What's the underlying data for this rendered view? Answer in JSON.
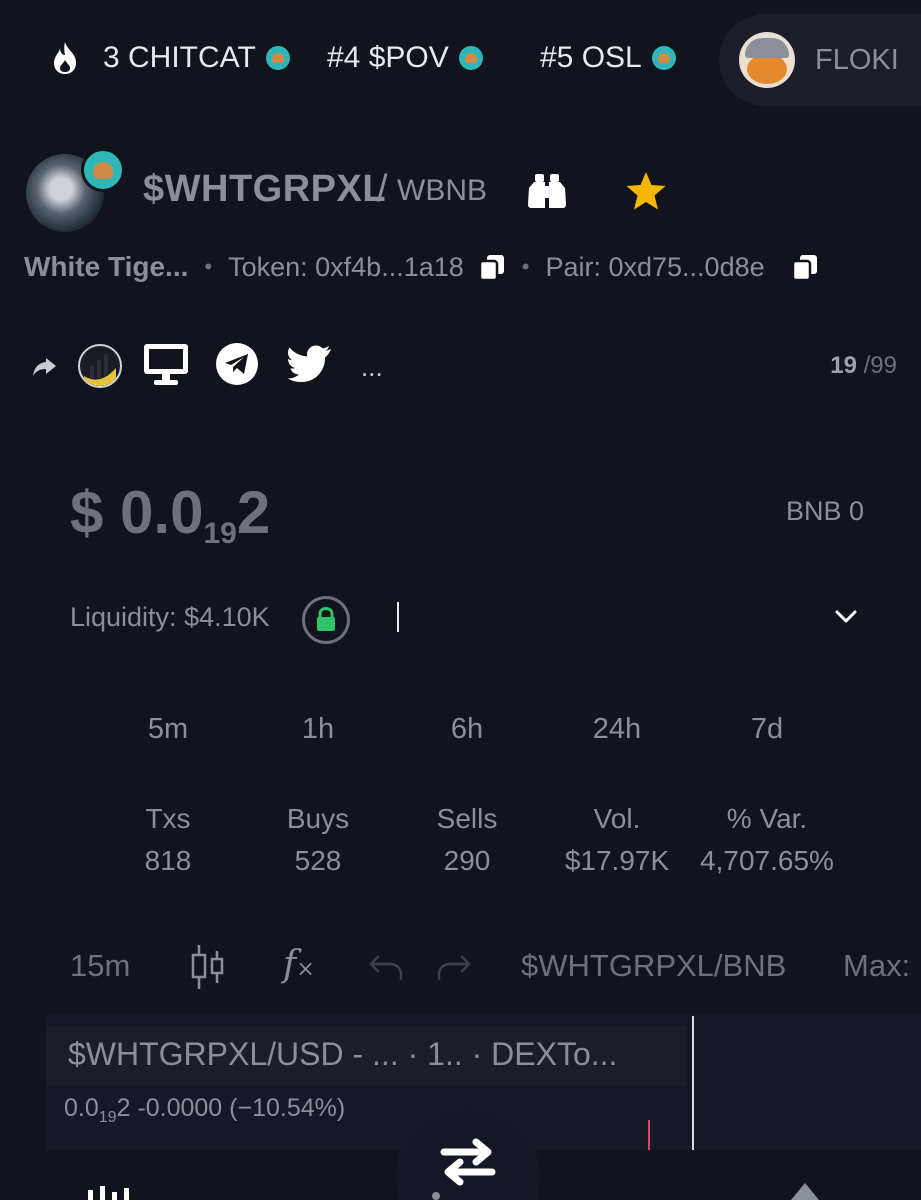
{
  "ticker": {
    "items": [
      {
        "label": "3 CHITCAT"
      },
      {
        "label": "#4 $POV"
      },
      {
        "label": "#5 OSL"
      }
    ],
    "highlight": {
      "label": "FLOKI"
    }
  },
  "token": {
    "symbol": "$WHTGRPXL",
    "slash": "/",
    "quote": "WBNB",
    "name": "White Tige...",
    "token_address": "Token: 0xf4b...1a18",
    "pair_address": "Pair: 0xd75...0d8e"
  },
  "social": {
    "more_label": "...",
    "rank_current": "19",
    "rank_total": " /99"
  },
  "price": {
    "prefix": "$ 0.0",
    "zeros": "19",
    "suffix": "2",
    "bnb": "BNB 0"
  },
  "liquidity": {
    "label": "Liquidity: $4.10K"
  },
  "periods": [
    "5m",
    "1h",
    "6h",
    "24h",
    "7d"
  ],
  "stats": [
    {
      "label": "Txs",
      "value": "818"
    },
    {
      "label": "Buys",
      "value": "528"
    },
    {
      "label": "Sells",
      "value": "290"
    },
    {
      "label": "Vol.",
      "value": "$17.97K"
    },
    {
      "label": "% Var.",
      "value": "4,707.65%"
    }
  ],
  "chart_toolbar": {
    "interval": "15m",
    "pair": "$WHTGRPXL/BNB",
    "max": "Max:"
  },
  "chart_legend": {
    "title": "$WHTGRPXL/USD - ...  · 1.. · DEXTo...",
    "price_prefix": "0.0",
    "price_zeros": "19",
    "price_suffix": "2",
    "change": "  -0.0000 (−10.54%)"
  },
  "colors": {
    "background": "#12141d",
    "star": "#f5b800",
    "lock": "#2fc46a",
    "badge": "#2fb7b7"
  }
}
